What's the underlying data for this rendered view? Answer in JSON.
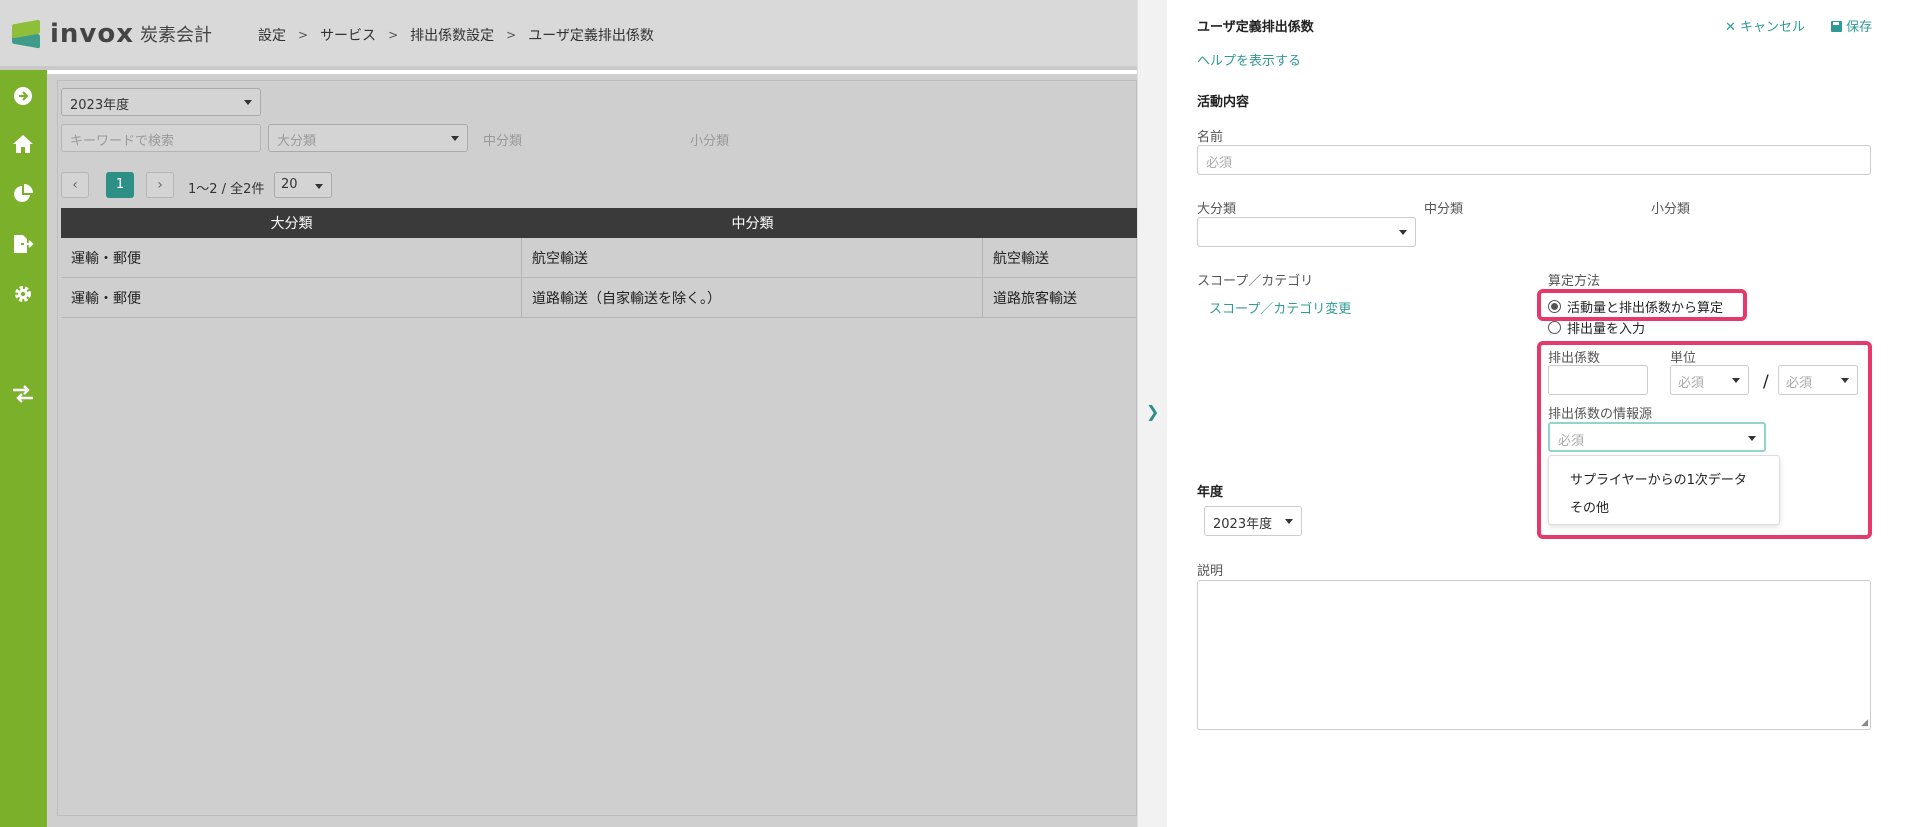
{
  "header": {
    "brand": "invox",
    "brand_sub": "炭素会計",
    "breadcrumb": [
      "設定",
      "サービス",
      "排出係数設定",
      "ユーザ定義排出係数"
    ]
  },
  "sidebar": {
    "items": [
      {
        "icon": "arrow-right-circle-icon"
      },
      {
        "icon": "home-icon"
      },
      {
        "icon": "pie-chart-icon"
      },
      {
        "icon": "file-export-icon"
      },
      {
        "icon": "gear-icon"
      },
      {
        "icon": "exchange-icon"
      }
    ]
  },
  "filters": {
    "year": "2023年度",
    "keyword_placeholder": "キーワードで検索",
    "major_placeholder": "大分類",
    "middle_label": "中分類",
    "minor_label": "小分類"
  },
  "pager": {
    "current": "1",
    "summary": "1〜2 / 全2件",
    "per_page": "20"
  },
  "table": {
    "headers": [
      "大分類",
      "中分類"
    ],
    "rows": [
      [
        "運輸・郵便",
        "航空輸送",
        "航空輸送"
      ],
      [
        "運輸・郵便",
        "道路輸送（自家輸送を除く。）",
        "道路旅客輸送"
      ]
    ]
  },
  "panel": {
    "title": "ユーザ定義排出係数",
    "cancel_label": "キャンセル",
    "save_label": "保存",
    "help_link": "ヘルプを表示する",
    "section_activity": "活動内容",
    "name_label": "名前",
    "name_placeholder": "必須",
    "major_label": "大分類",
    "middle_label": "中分類",
    "minor_label": "小分類",
    "scope_label": "スコープ／カテゴリ",
    "scope_link": "スコープ／カテゴリ変更",
    "calc_label": "算定方法",
    "calc_options": [
      "活動量と排出係数から算定",
      "排出量を入力"
    ],
    "calc_selected": 0,
    "factor_label": "排出係数",
    "unit_label": "単位",
    "unit_placeholder_1": "必須",
    "unit_placeholder_2": "必須",
    "unit_sep": "/",
    "source_label": "排出係数の情報源",
    "source_placeholder": "必須",
    "source_options": [
      "サプライヤーからの1次データ",
      "その他"
    ],
    "year_label": "年度",
    "year_value": "2023年度",
    "description_label": "説明"
  },
  "colors": {
    "sidebar": "#7bb12a",
    "accent": "#2e9b96",
    "highlight": "#e6386a"
  }
}
